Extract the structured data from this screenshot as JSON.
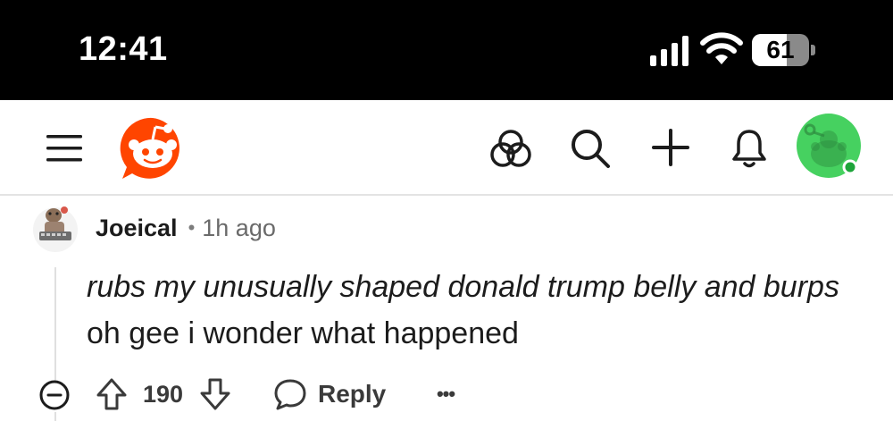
{
  "status_bar": {
    "time": "12:41",
    "battery_percent": "61",
    "battery_level": 0.61
  },
  "header": {
    "icons": [
      "menu-icon",
      "reddit-logo-icon",
      "popular-icon",
      "search-icon",
      "plus-icon",
      "bell-icon",
      "user-avatar-icon"
    ],
    "accent_color": "#ff4500",
    "avatar_bg": "#46d160"
  },
  "comment": {
    "username": "Joeical",
    "separator": "•",
    "time_ago": "1h ago",
    "body_italic": "rubs my unusually shaped donald trump belly and burps",
    "body_plain": " oh gee i wonder what happened",
    "vote_count": "190",
    "reply_label": "Reply",
    "more_label": "•••"
  }
}
